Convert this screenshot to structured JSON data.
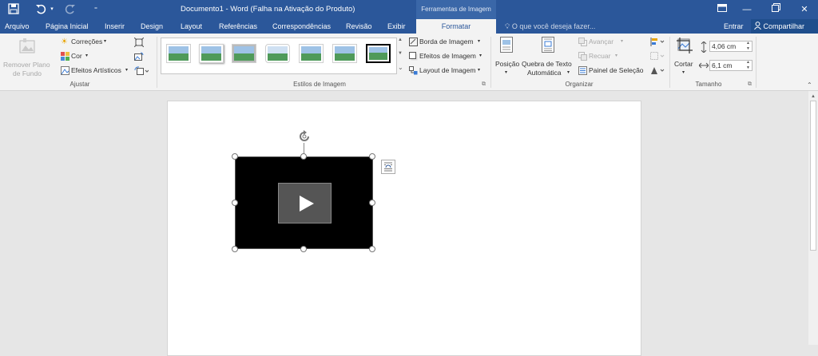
{
  "titlebar": {
    "window_title": "Documento1 - Word (Falha na Ativação do Produto)",
    "context_tab_group": "Ferramentas de Imagem",
    "save_icon": "save-icon",
    "undo_icon": "undo-icon",
    "redo_icon": "redo-icon"
  },
  "tabs": {
    "items": [
      "Arquivo",
      "Página Inicial",
      "Inserir",
      "Design",
      "Layout",
      "Referências",
      "Correspondências",
      "Revisão",
      "Exibir"
    ],
    "active": "Formatar",
    "tell_me_placeholder": "O que você deseja fazer...",
    "sign_in": "Entrar",
    "share": "Compartilhar"
  },
  "ribbon": {
    "ajustar": {
      "remove_bg": "Remover Plano de Fundo",
      "remove_bg_line1": "Remover Plano",
      "remove_bg_line2": "de Fundo",
      "correcoes": "Correções",
      "cor": "Cor",
      "efeitos_artisticos": "Efeitos Artísticos",
      "group_label": "Ajustar"
    },
    "estilos": {
      "group_label": "Estilos de Imagem",
      "borda": "Borda de Imagem",
      "efeitos": "Efeitos de Imagem",
      "layout": "Layout de Imagem"
    },
    "organizar": {
      "posicao": "Posição",
      "quebra_line1": "Quebra de Texto",
      "quebra_line2": "Automática",
      "avancar": "Avançar",
      "recuar": "Recuar",
      "painel": "Painel de Seleção",
      "group_label": "Organizar"
    },
    "tamanho": {
      "cortar": "Cortar",
      "height": "4,06 cm",
      "width": "6,1 cm",
      "group_label": "Tamanho"
    }
  },
  "colors": {
    "word_blue": "#2b579a",
    "ribbon_bg": "#f3f3f3",
    "workspace_bg": "#e6e6e6"
  }
}
